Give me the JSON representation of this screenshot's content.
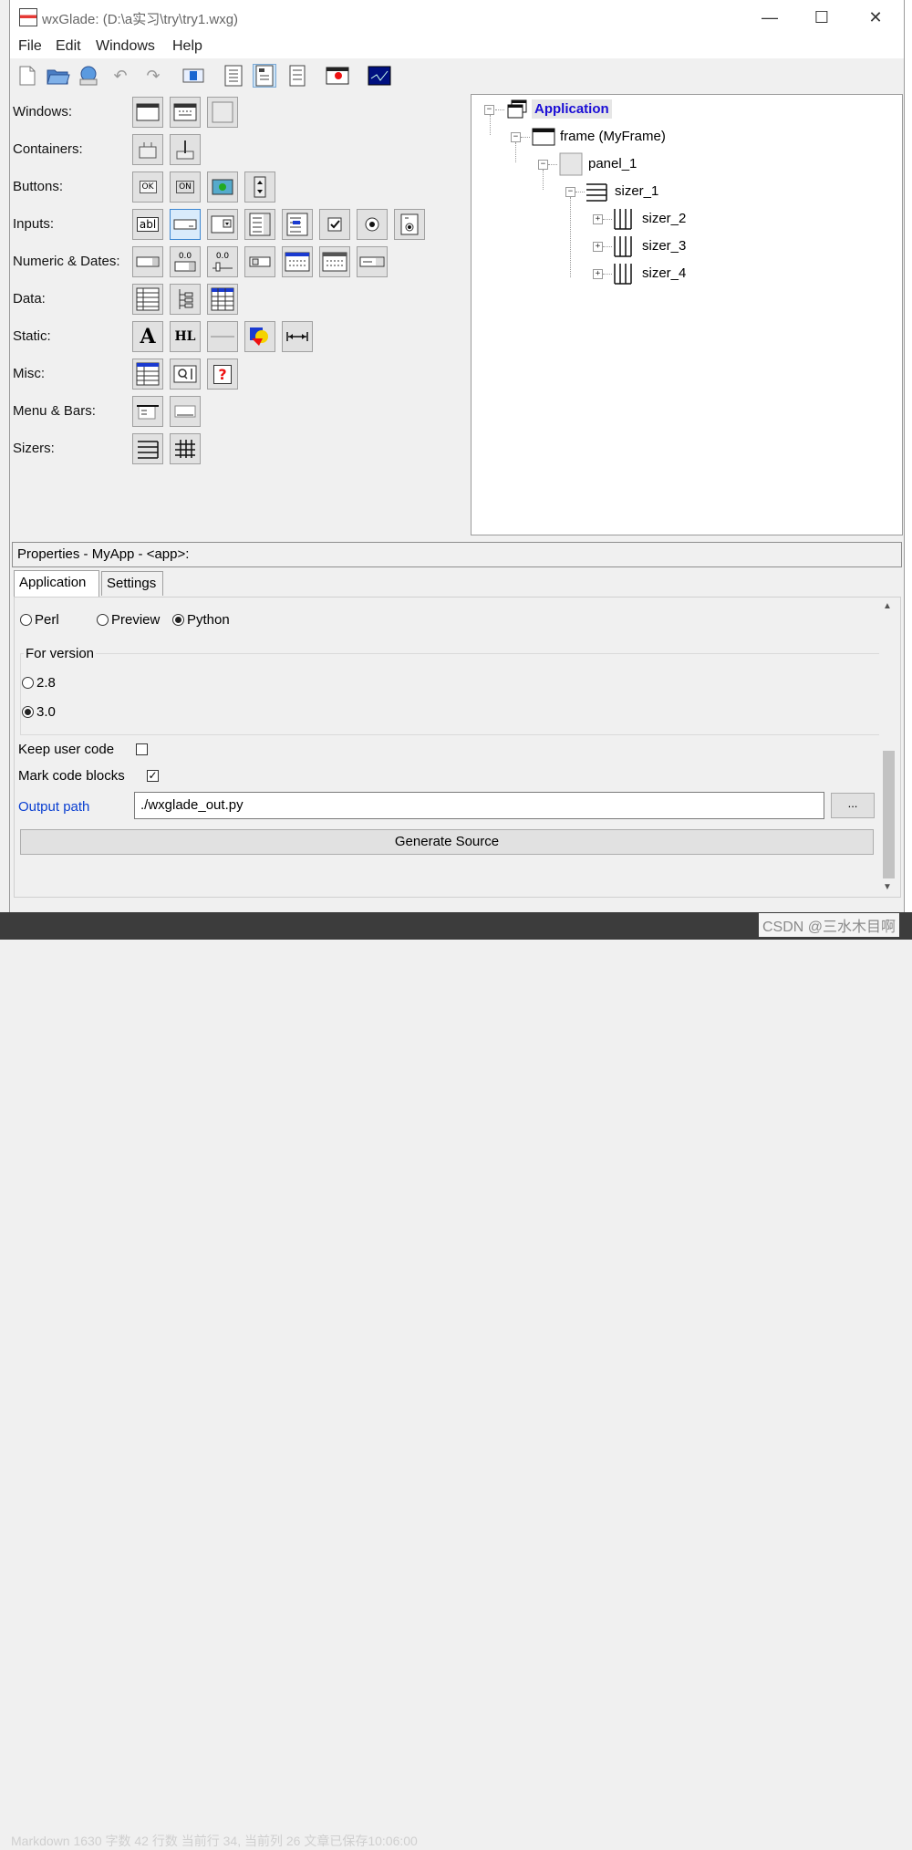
{
  "window": {
    "title": "wxGlade: (D:\\a实习\\try\\try1.wxg)",
    "controls": {
      "minimize": "—",
      "maximize": "☐",
      "close": "✕"
    }
  },
  "menu": [
    "File",
    "Edit",
    "Windows",
    "Help"
  ],
  "toolbar_icons": [
    "new-icon",
    "open-icon",
    "save-icon",
    "undo-icon",
    "redo-icon",
    "layout-icon",
    "view-tree-icon",
    "view-props-icon",
    "view-palette-icon",
    "preview-icon",
    "shell-icon"
  ],
  "palette": {
    "rows": [
      {
        "label": "Windows:",
        "buttons": [
          "frame-icon",
          "dialog-icon",
          "panel-icon"
        ]
      },
      {
        "label": "Containers:",
        "buttons": [
          "splitter-icon",
          "notebook-icon"
        ]
      },
      {
        "label": "Buttons:",
        "buttons": [
          "OK",
          "ON",
          "bitmap-button-icon",
          "spin-button-icon"
        ]
      },
      {
        "label": "Inputs:",
        "buttons": [
          "abl",
          "combobox-icon",
          "choice-icon",
          "listbox-icon",
          "checklist-icon",
          "checkbox-icon",
          "radio-icon",
          "radiobox-icon"
        ]
      },
      {
        "label": "Numeric & Dates:",
        "buttons": [
          "spinctrl-icon",
          "0.0",
          "0.0",
          "slider-icon",
          "calendar-icon",
          "datepicker-icon",
          "timepicker-icon"
        ]
      },
      {
        "label": "Data:",
        "buttons": [
          "grid-icon",
          "tree-icon",
          "list-icon"
        ]
      },
      {
        "label": "Static:",
        "buttons": [
          "A",
          "HL",
          "line-icon",
          "bitmap-icon",
          "spacer-icon"
        ]
      },
      {
        "label": "Misc:",
        "buttons": [
          "property-grid-icon",
          "search-icon",
          "?"
        ]
      },
      {
        "label": "Menu & Bars:",
        "buttons": [
          "menubar-icon",
          "statusbar-icon"
        ]
      },
      {
        "label": "Sizers:",
        "buttons": [
          "boxsizer-icon",
          "gridsizer-icon"
        ]
      }
    ]
  },
  "tree": {
    "application": "Application",
    "frame": "frame (MyFrame)",
    "panel": "panel_1",
    "sizer1": "sizer_1",
    "children": [
      "sizer_2",
      "sizer_3",
      "sizer_4"
    ]
  },
  "properties": {
    "header": "Properties - MyApp - <app>:",
    "tabs": [
      "Application",
      "Settings"
    ],
    "language_options": [
      "Perl",
      "Preview",
      "Python"
    ],
    "language_selected": "Python",
    "version_group_label": "For version",
    "version_options": [
      "2.8",
      "3.0"
    ],
    "version_selected": "3.0",
    "keep_user_code_label": "Keep user code",
    "keep_user_code": false,
    "mark_code_blocks_label": "Mark code blocks",
    "mark_code_blocks": true,
    "output_path_label": "Output path",
    "output_path_value": "./wxglade_out.py",
    "browse_label": "...",
    "generate_label": "Generate Source"
  },
  "background": {
    "statusbar_text": "Markdown  1630 字数  42 行数  当前行 34, 当前列 26  文章已保存10:06:00",
    "watermark": "CSDN @三水木目啊"
  },
  "colors": {
    "accent": "#1a0dd6",
    "link": "#0a3fd1"
  }
}
